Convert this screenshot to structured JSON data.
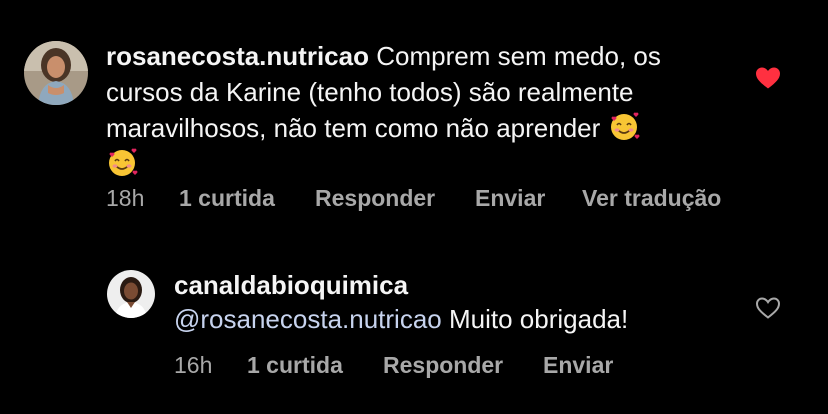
{
  "comments": [
    {
      "username": "rosanecosta.nutricao",
      "text_line1": "Comprem sem medo, os",
      "text_line2": "cursos da Karine (tenho todos) são realmente",
      "text_line3": "maravilhosos, não tem como não aprender",
      "emoji": "smiling-face-with-hearts-icon",
      "time": "18h",
      "likes": "1 curtida",
      "reply_label": "Responder",
      "send_label": "Enviar",
      "translate_label": "Ver tradução",
      "liked": true,
      "heart_color": "#ff3040"
    },
    {
      "username": "canaldabioquimica",
      "mention": "@rosanecosta.nutricao",
      "text": "Muito obrigada!",
      "time": "16h",
      "likes": "1 curtida",
      "reply_label": "Responder",
      "send_label": "Enviar",
      "liked": false
    }
  ],
  "colors": {
    "background": "#000000",
    "text": "#f5f5f5",
    "meta_text": "#a8a8a8",
    "mention": "#c7d3ee",
    "like_active": "#ff3040"
  }
}
